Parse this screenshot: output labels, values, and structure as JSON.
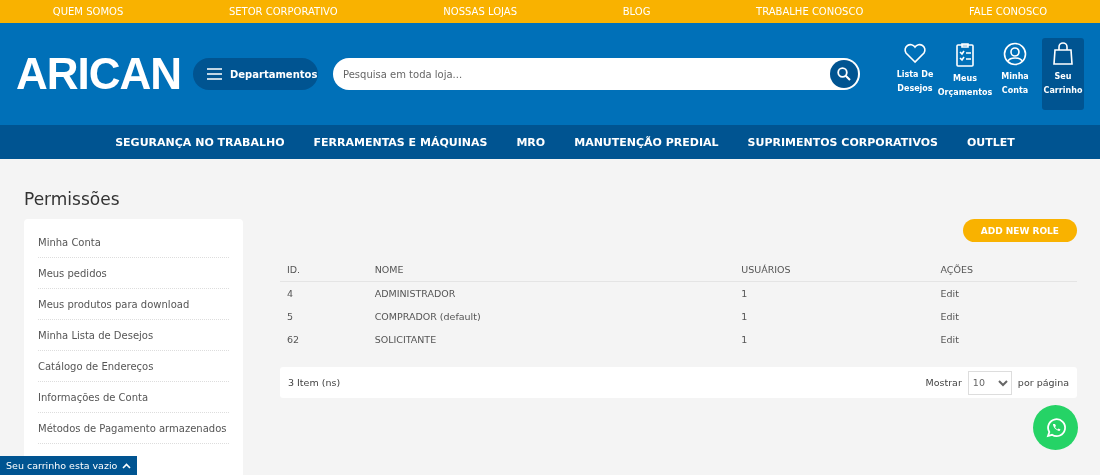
{
  "top_links": [
    "QUEM SOMOS",
    "SETOR CORPORATIVO",
    "NOSSAS LOJAS",
    "BLOG",
    "TRABALHE CONOSCO",
    "FALE CONOSCO"
  ],
  "header": {
    "logo": "ARICAN",
    "departments": "Departamentos",
    "search": {
      "placeholder": "Pesquisa em toda loja..."
    },
    "actions": [
      {
        "kind": "heart",
        "label": [
          "Lista De",
          "Desejos"
        ],
        "selected": false
      },
      {
        "kind": "clipboard",
        "label": [
          "Meus",
          "Orçamentos"
        ],
        "selected": false
      },
      {
        "kind": "user",
        "label": [
          "Minha",
          "Conta"
        ],
        "selected": false
      },
      {
        "kind": "bag",
        "label": [
          "Seu",
          "Carrinho"
        ],
        "selected": true
      }
    ]
  },
  "nav": [
    "SEGURANÇA NO TRABALHO",
    "FERRAMENTAS E MÁQUINAS",
    "MRO",
    "MANUTENÇÃO PREDIAL",
    "SUPRIMENTOS CORPORATIVOS",
    "OUTLET"
  ],
  "page_title": "Permissões",
  "sidebar": {
    "items": [
      "Minha Conta",
      "Meus pedidos",
      "Meus produtos para download",
      "Minha Lista de Desejos",
      "Catálogo de Endereços",
      "Informações de Conta",
      "Métodos de Pagamento armazenados"
    ]
  },
  "add_button": "ADD NEW ROLE",
  "table": {
    "columns": [
      "ID.",
      "NOME",
      "USUÁRIOS",
      "AÇÕES"
    ],
    "rows": [
      [
        "4",
        "ADMINISTRADOR",
        "1",
        "Edit"
      ],
      [
        "5",
        "COMPRADOR (default)",
        "1",
        "Edit"
      ],
      [
        "62",
        "SOLICITANTE",
        "1",
        "Edit"
      ]
    ]
  },
  "pager": {
    "count": "3 Item (ns)",
    "show": "Mostrar",
    "per_page_value": "10",
    "per_page": "por página"
  },
  "cart_bar": "Seu carrinho esta vazio"
}
